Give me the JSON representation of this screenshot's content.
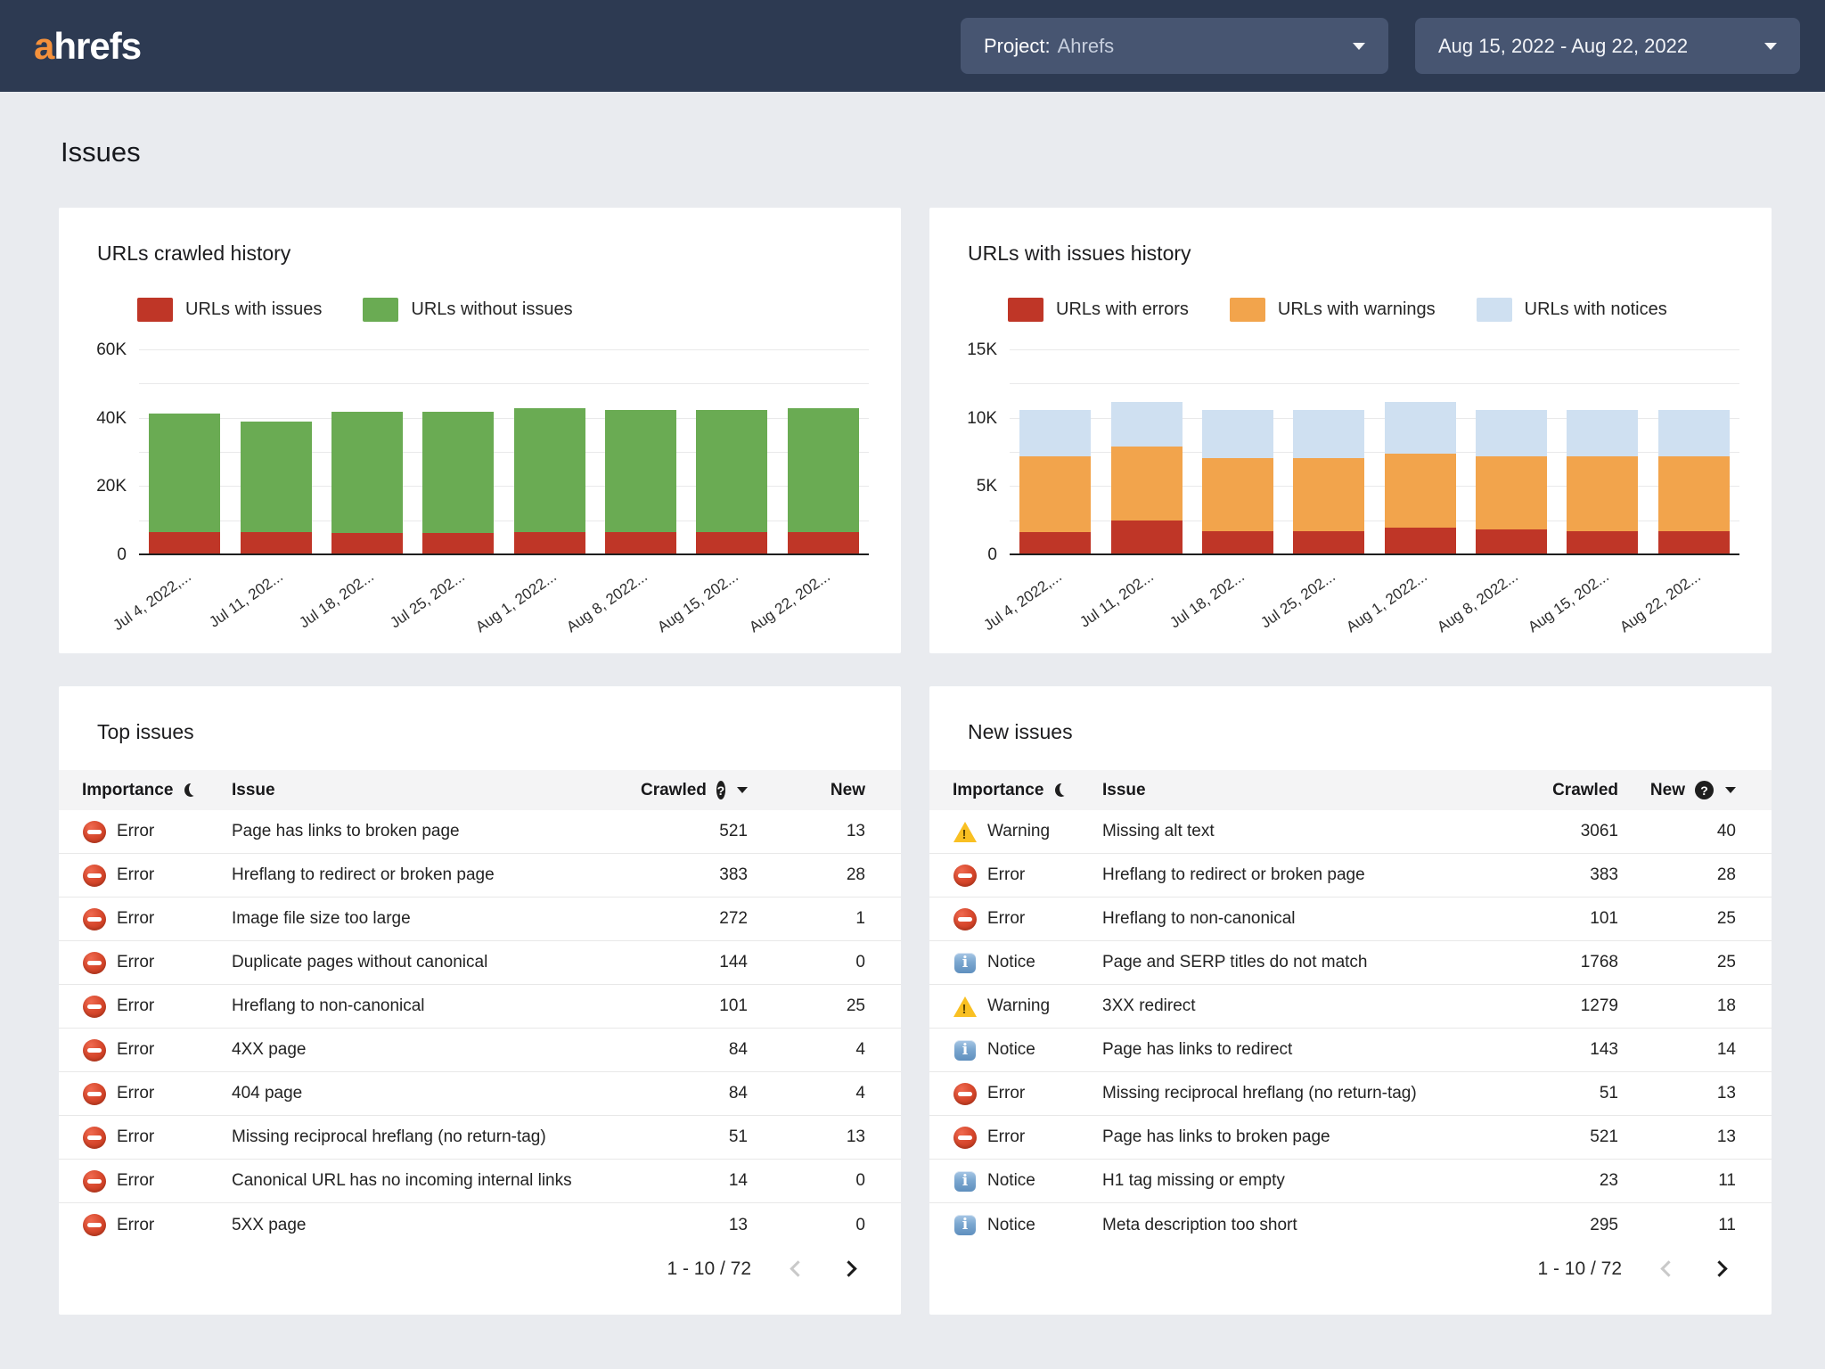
{
  "header": {
    "logo_a": "a",
    "logo_rest": "hrefs",
    "project_label": "Project:",
    "project_value": "Ahrefs",
    "date_range": "Aug 15, 2022 - Aug 22, 2022"
  },
  "page_title": "Issues",
  "colors": {
    "header_bg": "#2d3a52",
    "header_button_bg": "#475571",
    "page_bg": "#e9ebef",
    "logo_orange": "#f5913b",
    "chart_red": "#bf3627",
    "chart_green": "#6aab53",
    "chart_orange": "#f2a44c",
    "chart_light_blue": "#cfe0f1"
  },
  "chart_data": [
    {
      "type": "bar",
      "stacked": true,
      "title": "URLs crawled history",
      "categories": [
        "Jul 4, 2022,...",
        "Jul 11, 202...",
        "Jul 18, 202...",
        "Jul 25, 202...",
        "Aug 1, 2022...",
        "Aug 8, 2022...",
        "Aug 15, 202...",
        "Aug 22, 202..."
      ],
      "series": [
        {
          "name": "URLs with issues",
          "color": "#bf3627",
          "values": [
            6200,
            6300,
            6000,
            5900,
            6200,
            6200,
            6300,
            6300
          ]
        },
        {
          "name": "URLs without issues",
          "color": "#6aab53",
          "values": [
            34800,
            32200,
            35500,
            35600,
            36300,
            35800,
            35700,
            36200
          ]
        }
      ],
      "xlabel": "",
      "ylabel": "",
      "ylim": [
        0,
        60000
      ],
      "yticks": [
        {
          "value": 60000,
          "label": "60K"
        },
        {
          "value": 40000,
          "label": "40K"
        },
        {
          "value": 20000,
          "label": "20K"
        },
        {
          "value": 0,
          "label": "0"
        }
      ],
      "grid_step": 10000,
      "grid": true,
      "legend_position": "top"
    },
    {
      "type": "bar",
      "stacked": true,
      "title": "URLs with issues history",
      "categories": [
        "Jul 4, 2022,...",
        "Jul 11, 202...",
        "Jul 18, 202...",
        "Jul 25, 202...",
        "Aug 1, 2022...",
        "Aug 8, 2022...",
        "Aug 15, 202...",
        "Aug 22, 202..."
      ],
      "series": [
        {
          "name": "URLs with errors",
          "color": "#bf3627",
          "values": [
            1550,
            2400,
            1600,
            1650,
            1900,
            1750,
            1600,
            1600
          ]
        },
        {
          "name": "URLs with warnings",
          "color": "#f2a44c",
          "values": [
            5550,
            5400,
            5400,
            5350,
            5400,
            5350,
            5500,
            5500
          ]
        },
        {
          "name": "URLs with notices",
          "color": "#cfe0f1",
          "values": [
            3400,
            3300,
            3500,
            3500,
            3800,
            3400,
            3400,
            3400
          ]
        }
      ],
      "xlabel": "",
      "ylabel": "",
      "ylim": [
        0,
        15000
      ],
      "yticks": [
        {
          "value": 15000,
          "label": "15K"
        },
        {
          "value": 10000,
          "label": "10K"
        },
        {
          "value": 5000,
          "label": "5K"
        },
        {
          "value": 0,
          "label": "0"
        }
      ],
      "grid_step": 2500,
      "grid": true,
      "legend_position": "top"
    }
  ],
  "tables": [
    {
      "title": "Top issues",
      "header": {
        "importance": "Importance",
        "issue": "Issue",
        "crawled": "Crawled",
        "new": "New"
      },
      "rows": [
        {
          "type": "error",
          "importance": "Error",
          "issue": "Page has links to broken page",
          "crawled": "521",
          "new": "13"
        },
        {
          "type": "error",
          "importance": "Error",
          "issue": "Hreflang to redirect or broken page",
          "crawled": "383",
          "new": "28"
        },
        {
          "type": "error",
          "importance": "Error",
          "issue": "Image file size too large",
          "crawled": "272",
          "new": "1"
        },
        {
          "type": "error",
          "importance": "Error",
          "issue": "Duplicate pages without canonical",
          "crawled": "144",
          "new": "0"
        },
        {
          "type": "error",
          "importance": "Error",
          "issue": "Hreflang to non-canonical",
          "crawled": "101",
          "new": "25"
        },
        {
          "type": "error",
          "importance": "Error",
          "issue": "4XX page",
          "crawled": "84",
          "new": "4"
        },
        {
          "type": "error",
          "importance": "Error",
          "issue": "404 page",
          "crawled": "84",
          "new": "4"
        },
        {
          "type": "error",
          "importance": "Error",
          "issue": "Missing reciprocal hreflang (no return-tag)",
          "crawled": "51",
          "new": "13"
        },
        {
          "type": "error",
          "importance": "Error",
          "issue": "Canonical URL has no incoming internal links",
          "crawled": "14",
          "new": "0"
        },
        {
          "type": "error",
          "importance": "Error",
          "issue": "5XX page",
          "crawled": "13",
          "new": "0"
        }
      ],
      "pagination": "1 - 10 / 72"
    },
    {
      "title": "New issues",
      "header": {
        "importance": "Importance",
        "issue": "Issue",
        "crawled": "Crawled",
        "new": "New"
      },
      "rows": [
        {
          "type": "warning",
          "importance": "Warning",
          "issue": "Missing alt text",
          "crawled": "3061",
          "new": "40"
        },
        {
          "type": "error",
          "importance": "Error",
          "issue": "Hreflang to redirect or broken page",
          "crawled": "383",
          "new": "28"
        },
        {
          "type": "error",
          "importance": "Error",
          "issue": "Hreflang to non-canonical",
          "crawled": "101",
          "new": "25"
        },
        {
          "type": "notice",
          "importance": "Notice",
          "issue": "Page and SERP titles do not match",
          "crawled": "1768",
          "new": "25"
        },
        {
          "type": "warning",
          "importance": "Warning",
          "issue": "3XX redirect",
          "crawled": "1279",
          "new": "18"
        },
        {
          "type": "notice",
          "importance": "Notice",
          "issue": "Page has links to redirect",
          "crawled": "143",
          "new": "14"
        },
        {
          "type": "error",
          "importance": "Error",
          "issue": "Missing reciprocal hreflang (no return-tag)",
          "crawled": "51",
          "new": "13"
        },
        {
          "type": "error",
          "importance": "Error",
          "issue": "Page has links to broken page",
          "crawled": "521",
          "new": "13"
        },
        {
          "type": "notice",
          "importance": "Notice",
          "issue": "H1 tag missing or empty",
          "crawled": "23",
          "new": "11"
        },
        {
          "type": "notice",
          "importance": "Notice",
          "issue": "Meta description too short",
          "crawled": "295",
          "new": "11"
        }
      ],
      "pagination": "1 - 10 / 72"
    }
  ]
}
